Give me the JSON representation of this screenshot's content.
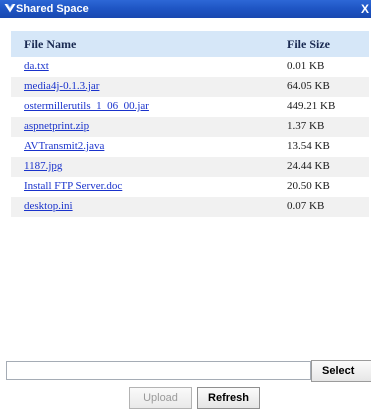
{
  "window": {
    "title": "Shared Space",
    "close_glyph": "X",
    "logo_icon": "shared-space-logo-icon",
    "titlebar_color": "#1f56c5"
  },
  "table": {
    "header_color": "#d6e7f8",
    "columns": {
      "name": "File Name",
      "size": "File Size"
    },
    "rows": [
      {
        "name": "da.txt",
        "size": "0.01 KB"
      },
      {
        "name": "media4j-0.1.3.jar",
        "size": "64.05 KB"
      },
      {
        "name": "ostermillerutils_1_06_00.jar",
        "size": "449.21 KB"
      },
      {
        "name": "aspnetprint.zip",
        "size": "1.37 KB"
      },
      {
        "name": "AVTransmit2.java",
        "size": "13.54 KB"
      },
      {
        "name": "1187.jpg",
        "size": "24.44 KB"
      },
      {
        "name": "Install FTP Server.doc",
        "size": "20.50 KB"
      },
      {
        "name": "desktop.ini",
        "size": "0.07 KB"
      }
    ]
  },
  "upload_form": {
    "file_value": "",
    "select_label": "Select",
    "upload_label": "Upload",
    "refresh_label": "Refresh"
  }
}
